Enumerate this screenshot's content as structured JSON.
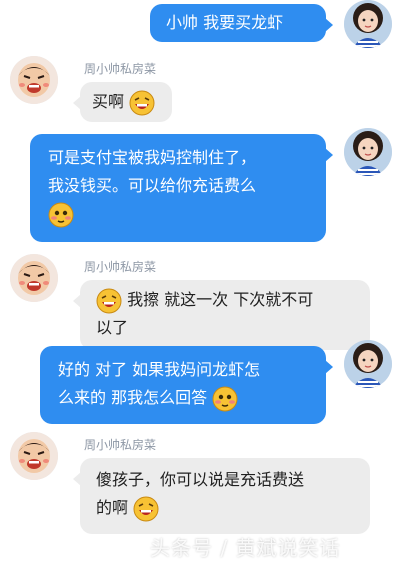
{
  "colors": {
    "outgoing_bubble": "#2f8df0",
    "incoming_bubble": "#ececec",
    "sender_name": "#8d97a5"
  },
  "contact": {
    "name": "周小帅私房菜"
  },
  "messages": [
    {
      "side": "out",
      "lines": [
        "小帅 我要买龙虾"
      ]
    },
    {
      "side": "in",
      "sender": "周小帅私房菜",
      "lines": [
        "买啊"
      ],
      "emoji": "laughing-emoji-icon"
    },
    {
      "side": "out",
      "lines": [
        "可是支付宝被我妈控制住了，",
        "我没钱买。可以给你充话费么"
      ],
      "emoji": "blushing-emoji-icon"
    },
    {
      "side": "in",
      "sender": "周小帅私房菜",
      "lines": [
        "我擦 就这一次 下次就不可",
        "以了"
      ],
      "emoji": "grinning-emoji-icon"
    },
    {
      "side": "out",
      "lines": [
        "好的 对了 如果我妈问龙虾怎",
        "么来的 那我怎么回答"
      ],
      "emoji": "blushing-emoji-icon"
    },
    {
      "side": "in",
      "sender": "周小帅私房菜",
      "lines": [
        "傻孩子，你可以说是充话费送",
        "的啊"
      ],
      "emoji": "laughing-emoji-icon"
    }
  ],
  "watermark": "头条号 / 黄斌说笑话"
}
